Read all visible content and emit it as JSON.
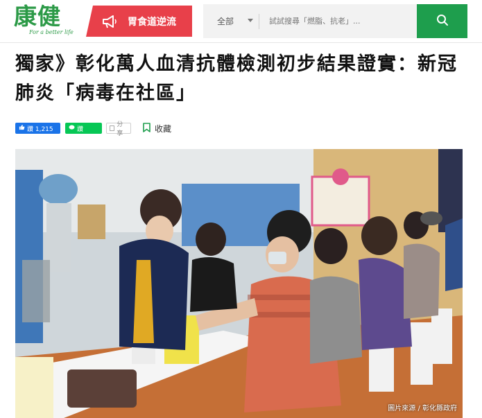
{
  "header": {
    "logo_text": "康健",
    "logo_tagline": "For a better life",
    "topic_button_label": "胃食道逆流",
    "search": {
      "category_selected": "全部",
      "placeholder": "試試搜尋「燃脂、抗老」..."
    }
  },
  "article": {
    "title": "獨家》彰化萬人血清抗體檢測初步結果證實：新冠肺炎「病毒在社區」",
    "share": {
      "facebook_label": "讚 1,215",
      "line_label": "讚",
      "share_label": "分享",
      "bookmark_label": "收藏"
    },
    "photo_caption": "圖片來源 / 彰化縣政府"
  },
  "colors": {
    "brand_green": "#2c9a47",
    "search_button_green": "#1e9e4d",
    "topic_red": "#e8404a",
    "facebook_blue": "#1a73e8",
    "line_green": "#06c755"
  },
  "icons": {
    "topic": "megaphone-icon",
    "search": "search-icon",
    "facebook": "thumbs-up-icon",
    "line": "line-icon",
    "bookmark": "bookmark-icon"
  }
}
